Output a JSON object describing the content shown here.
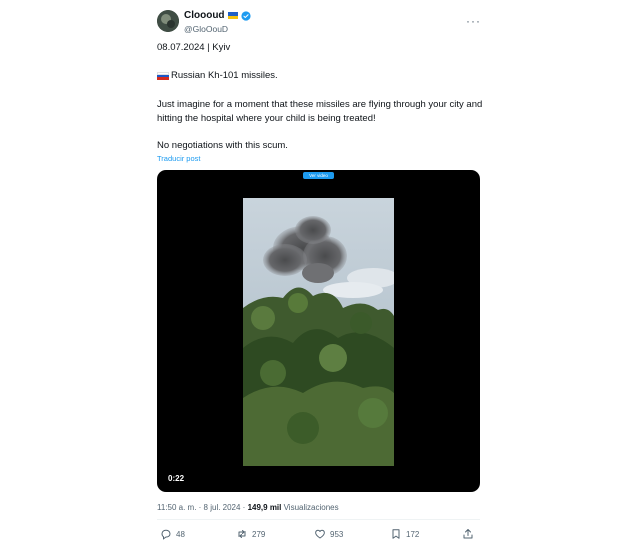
{
  "author": {
    "display_name": "Cloooud",
    "handle": "@GloOouD",
    "flag_icon": "ukraine-flag-icon",
    "verified_icon": "verified-badge-icon"
  },
  "tweet": {
    "date_location": "08.07.2024 | Kyiv",
    "title_flag_icon": "russia-flag-icon",
    "title": "Russian Kh-101 missiles.",
    "body": "Just imagine for a moment that these missiles are flying through your city and hitting the hospital where your child is being treated!",
    "no_negotiations": "No negotiations with this scum.",
    "translate_label": "Traducir post"
  },
  "media": {
    "type": "video",
    "badge": "Ver video",
    "duration": "0:22"
  },
  "meta": {
    "time_date": "11:50 a. m. · 8 jul. 2024 · ",
    "views_count": "149,9 mil",
    "views_label": " Visualizaciones"
  },
  "actions": {
    "replies": "48",
    "reposts": "279",
    "likes": "953",
    "bookmarks": "172"
  },
  "colors": {
    "accent": "#1d9bf0",
    "text_primary": "#0f1419",
    "text_secondary": "#536471"
  }
}
